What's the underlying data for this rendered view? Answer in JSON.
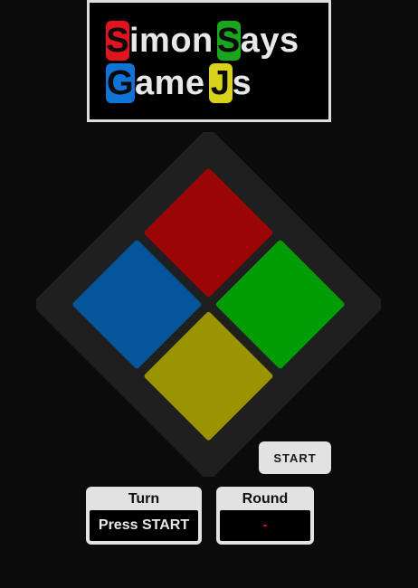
{
  "title": {
    "line1": [
      {
        "letter": "S",
        "tile_color": "#e0141e",
        "rest": "imon"
      },
      {
        "letter": "S",
        "tile_color": "#19a51e",
        "rest": "ays"
      }
    ],
    "line2": [
      {
        "letter": "G",
        "tile_color": "#1273d6",
        "rest": "ame"
      },
      {
        "letter": "J",
        "tile_color": "#d8d21a",
        "rest": "s"
      }
    ]
  },
  "board": {
    "background": "#1f1f1f",
    "pads": [
      {
        "name": "red",
        "color": "#9b0505"
      },
      {
        "name": "green",
        "color": "#029d04"
      },
      {
        "name": "yellow",
        "color": "#9a9402"
      },
      {
        "name": "blue",
        "color": "#04559b"
      }
    ]
  },
  "controls": {
    "start_label": "START"
  },
  "status": {
    "turn_label": "Turn",
    "turn_value": "Press START",
    "round_label": "Round",
    "round_value": "-"
  }
}
